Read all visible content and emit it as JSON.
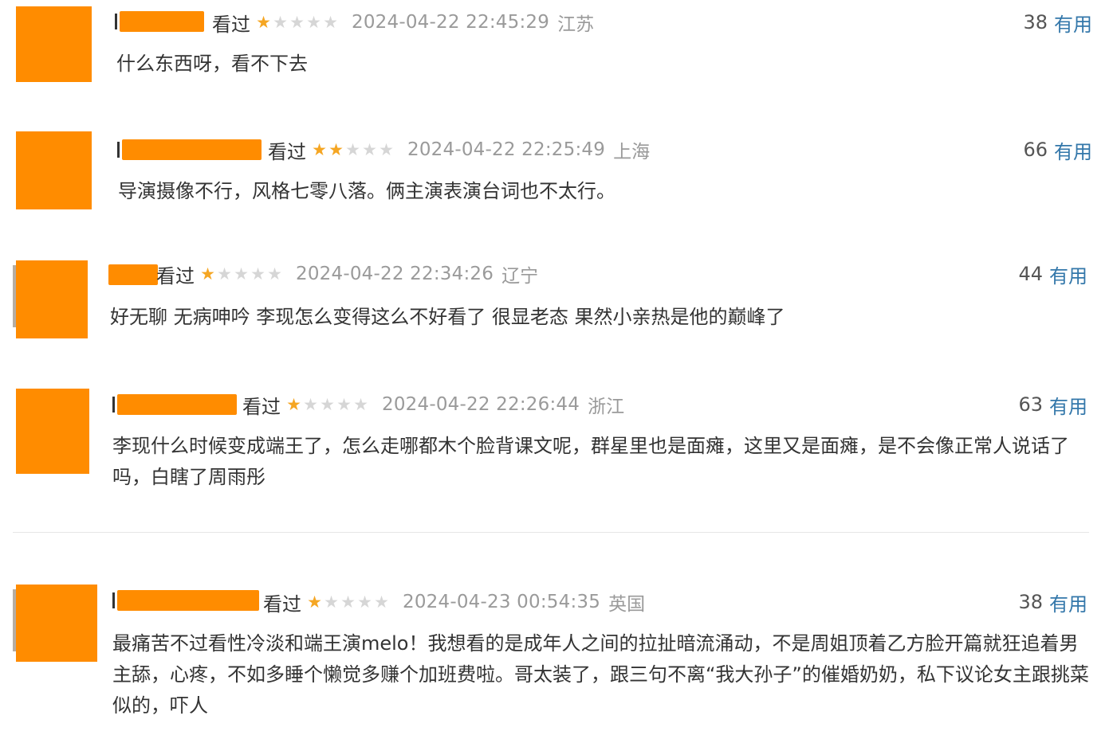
{
  "colors": {
    "redaction": "#ff8c00",
    "star_filled": "#f5a623",
    "star_empty": "#d6d6d6",
    "meta_gray": "#9a9a9a",
    "useful_blue": "#3377aa"
  },
  "comments": [
    {
      "status": "看过",
      "rating": 1,
      "time": "2024-04-22 22:45:29",
      "location": "江苏",
      "votes": "38",
      "votes_label": "有用",
      "text": "什么东西呀，看不下去"
    },
    {
      "status": "看过",
      "rating": 2,
      "time": "2024-04-22 22:25:49",
      "location": "上海",
      "votes": "66",
      "votes_label": "有用",
      "text": "导演摄像不行，风格七零八落。俩主演表演台词也不太行。"
    },
    {
      "status": "看过",
      "rating": 1,
      "time": "2024-04-22 22:34:26",
      "location": "辽宁",
      "votes": "44",
      "votes_label": "有用",
      "text": "好无聊 无病呻吟 李现怎么变得这么不好看了 很显老态 果然小亲热是他的巅峰了"
    },
    {
      "status": "看过",
      "rating": 1,
      "time": "2024-04-22 22:26:44",
      "location": "浙江",
      "votes": "63",
      "votes_label": "有用",
      "text": "李现什么时候变成端王了，怎么走哪都木个脸背课文呢，群星里也是面瘫，这里又是面瘫，是不会像正常人说话了吗，白瞎了周雨彤"
    },
    {
      "status": "看过",
      "rating": 1,
      "time": "2024-04-23 00:54:35",
      "location": "英国",
      "votes": "38",
      "votes_label": "有用",
      "text": "最痛苦不过看性冷淡和端王演melo！我想看的是成年人之间的拉扯暗流涌动，不是周姐顶着乙方脸开篇就狂追着男主舔，心疼，不如多睡个懒觉多赚个加班费啦。哥太装了，跟三句不离“我大孙子”的催婚奶奶，私下议论女主跟挑菜似的，吓人"
    }
  ]
}
